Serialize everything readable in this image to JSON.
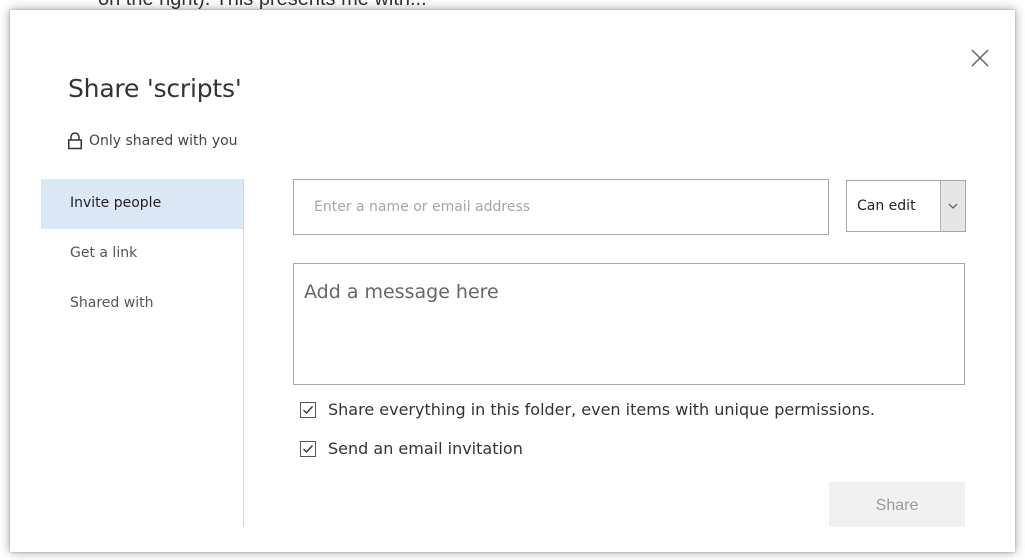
{
  "background_text": "on the right). This presents me with...",
  "dialog": {
    "title": "Share 'scripts'",
    "shared_status": "Only shared with you",
    "close_icon": "close-icon",
    "lock_icon": "lock-icon"
  },
  "sidebar": {
    "items": [
      {
        "label": "Invite people",
        "active": true
      },
      {
        "label": "Get a link",
        "active": false
      },
      {
        "label": "Shared with",
        "active": false
      }
    ]
  },
  "invite": {
    "placeholder": "Enter a name or email address",
    "value": "",
    "permission": "Can edit",
    "permission_arrow_icon": "chevron-down-icon"
  },
  "message": {
    "placeholder": "Add a message here",
    "value": ""
  },
  "options": {
    "share_everything_label": "Share everything in this folder, even items with unique permissions.",
    "share_everything_checked": true,
    "send_email_label": "Send an email invitation",
    "send_email_checked": true
  },
  "actions": {
    "share_label": "Share"
  },
  "colors": {
    "active_nav_bg": "#dbe9f6",
    "share_button_bg": "#f1f1f1",
    "share_button_text": "#9a9a9a"
  }
}
